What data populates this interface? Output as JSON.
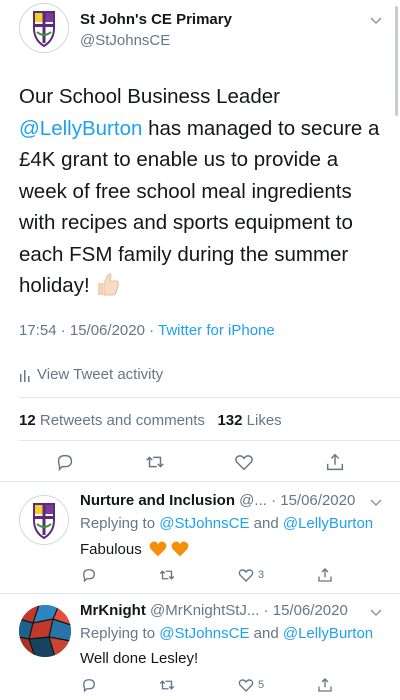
{
  "tweet": {
    "author_name": "St John's CE Primary",
    "author_handle": "@StJohnsCE",
    "text_before": "Our School Business Leader ",
    "mention": "@LellyBurton",
    "text_after": " has managed to secure a £4K grant to enable us to provide a week of free school meal ingredients with recipes and sports equipment to each FSM family during the summer holiday! ",
    "time_date": "17:54 · 15/06/2020 · ",
    "source": "Twitter for iPhone",
    "activity_label": "View Tweet activity",
    "retweets_count": "12",
    "retweets_label": "Retweets and comments",
    "likes_count": "132",
    "likes_label": "Likes"
  },
  "replies": [
    {
      "name": "Nurture and Inclusion",
      "handle_date": " @... · 15/06/2020",
      "replying_prefix": "Replying to ",
      "replying_to_1": "@StJohnsCE",
      "replying_and": " and ",
      "replying_to_2": "@LellyBurton",
      "text": "Fabulous",
      "likes": "3"
    },
    {
      "name": "MrKnight",
      "handle_date": " @MrKnightStJ... · 15/06/2020",
      "replying_prefix": "Replying to ",
      "replying_to_1": "@StJohnsCE",
      "replying_and": " and ",
      "replying_to_2": "@LellyBurton",
      "text": "Well done Lesley!",
      "likes": "5"
    }
  ],
  "icons": [
    "chevron-down-icon",
    "reply-icon",
    "retweet-icon",
    "like-icon",
    "share-icon",
    "analytics-icon",
    "thumbs-up-emoji",
    "orange-heart-emoji"
  ],
  "colors": {
    "link": "#1da1f2",
    "secondary": "#657786",
    "divider": "#e1e8ed",
    "heart_emoji": "#f4900c"
  }
}
